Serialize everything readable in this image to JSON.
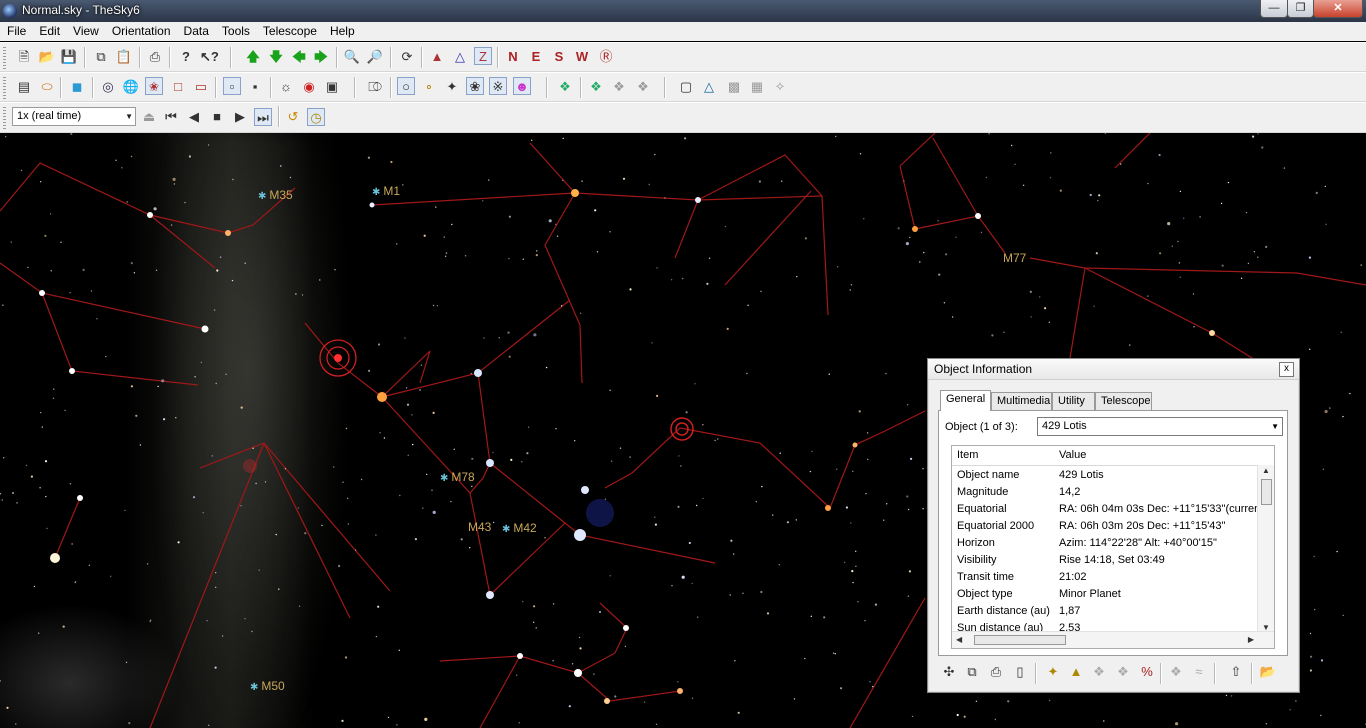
{
  "window": {
    "title": "Normal.sky - TheSky6"
  },
  "menu": [
    "File",
    "Edit",
    "View",
    "Orientation",
    "Data",
    "Tools",
    "Telescope",
    "Help"
  ],
  "speed_select": {
    "value": "1x (real time)"
  },
  "sky": {
    "labels": [
      {
        "id": "m35",
        "text": "M35"
      },
      {
        "id": "m1",
        "text": "M1"
      },
      {
        "id": "m77",
        "text": "M77"
      },
      {
        "id": "m78",
        "text": "M78"
      },
      {
        "id": "m43",
        "text": "M43"
      },
      {
        "id": "m42",
        "text": "M42"
      },
      {
        "id": "m50",
        "text": "M50"
      }
    ]
  },
  "object_info": {
    "title": "Object Information",
    "close_glyph": "x",
    "tabs": [
      "General",
      "Multimedia",
      "Utility",
      "Telescope"
    ],
    "object_label": "Object (1 of 3):",
    "object_value": "429 Lotis",
    "columns": [
      "Item",
      "Value"
    ],
    "rows": [
      {
        "item": "Object name",
        "value": "429 Lotis"
      },
      {
        "item": "Magnitude",
        "value": "14,2"
      },
      {
        "item": "Equatorial",
        "value": "RA: 06h 04m 03s   Dec: +11°15'33\"(curren"
      },
      {
        "item": "Equatorial 2000",
        "value": "RA: 06h 03m 20s   Dec: +11°15'43\""
      },
      {
        "item": "Horizon",
        "value": "Azim: 114°22'28\"   Alt: +40°00'15\""
      },
      {
        "item": "Visibility",
        "value": "Rise 14:18,  Set 03:49"
      },
      {
        "item": "Transit time",
        "value": "21:02"
      },
      {
        "item": "Object type",
        "value": "Minor Planet"
      },
      {
        "item": "Earth distance (au)",
        "value": "1,87"
      },
      {
        "item": "Sun distance (au)",
        "value": "2,53"
      }
    ]
  }
}
